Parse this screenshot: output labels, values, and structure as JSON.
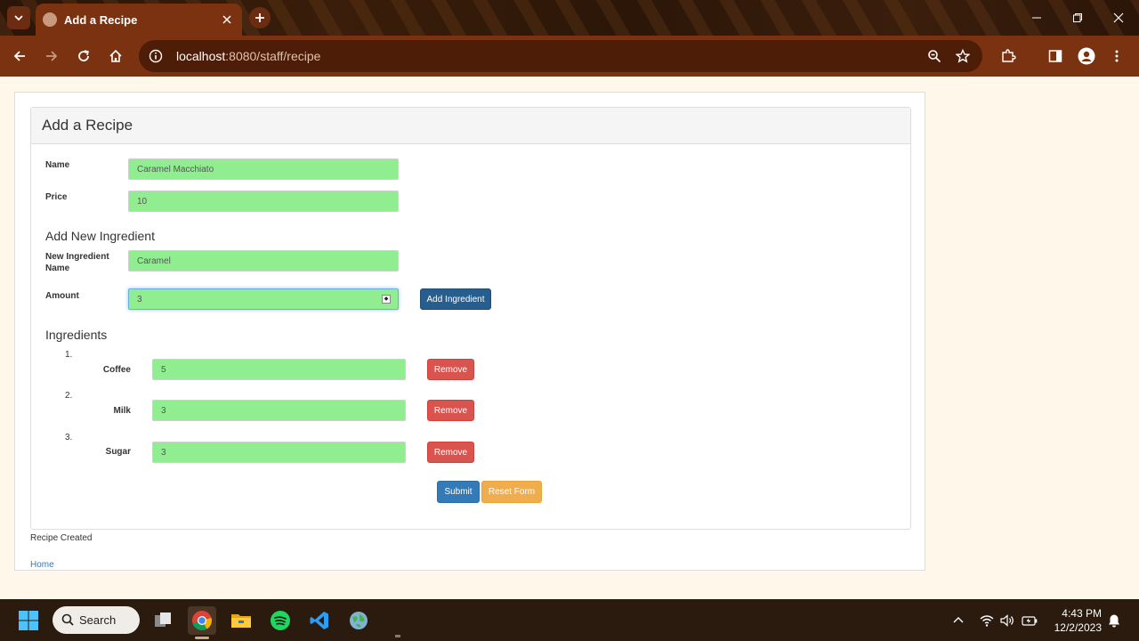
{
  "browser": {
    "tab_title": "Add a Recipe",
    "url_host": "localhost",
    "url_rest": ":8080/staff/recipe"
  },
  "panel": {
    "title": "Add a Recipe"
  },
  "form": {
    "name_label": "Name",
    "name_value": "Caramel Macchiato",
    "price_label": "Price",
    "price_value": "10",
    "add_ingredient_heading": "Add New Ingredient",
    "new_ingredient_label_1": "New Ingredient",
    "new_ingredient_label_2": "Name",
    "new_ingredient_value": "Caramel",
    "amount_label": "Amount",
    "amount_value": "3",
    "add_ingredient_button": "Add Ingredient"
  },
  "ingredients": {
    "heading": "Ingredients",
    "items": [
      {
        "index": "1.",
        "name": "Coffee",
        "amount": "5",
        "remove_label": "Remove"
      },
      {
        "index": "2.",
        "name": "Milk",
        "amount": "3",
        "remove_label": "Remove"
      },
      {
        "index": "3.",
        "name": "Sugar",
        "amount": "3",
        "remove_label": "Remove"
      }
    ]
  },
  "actions": {
    "submit_label": "Submit",
    "reset_label": "Reset Form"
  },
  "status_message": "Recipe Created",
  "home_link": "Home",
  "taskbar": {
    "search_label": "Search",
    "time": "4:43 PM",
    "date": "12/2/2023"
  },
  "colors": {
    "field_bg": "#90ee90",
    "chrome_brown": "#7a3210",
    "page_bg": "#fff8ea",
    "danger": "#d9534f",
    "primary": "#337ab7",
    "warning": "#f0ad4e"
  },
  "icons": [
    "tab-search-icon",
    "close-icon",
    "plus-icon",
    "back-icon",
    "forward-icon",
    "reload-icon",
    "home-icon",
    "site-info-icon",
    "zoom-icon",
    "star-icon",
    "extensions-icon",
    "side-panel-icon",
    "profile-icon",
    "menu-icon",
    "windows-start-icon",
    "search-icon",
    "task-view-icon",
    "chrome-icon",
    "file-explorer-icon",
    "spotify-icon",
    "vscode-icon",
    "globe-icon",
    "wifi-icon",
    "volume-icon",
    "battery-icon",
    "notification-icon"
  ]
}
